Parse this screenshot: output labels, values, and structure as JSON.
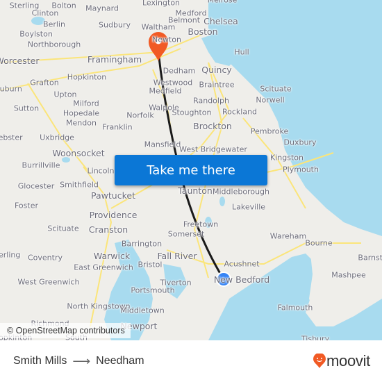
{
  "map": {
    "attribution": "© OpenStreetMap contributors",
    "colors": {
      "land": "#efeeea",
      "water": "#a8dbef",
      "road": "#fbe57a",
      "route_line": "#1a1a1a",
      "destination_pin": "#f15a24",
      "origin_dot": "#3584f5"
    },
    "origin": {
      "label": "Smith Mills",
      "icon": "origin-dot-icon"
    },
    "destination": {
      "label": "Needham",
      "icon": "destination-pin-icon"
    },
    "places": [
      {
        "name": "Sterling",
        "size": "s"
      },
      {
        "name": "Bolton",
        "size": "s"
      },
      {
        "name": "Maynard",
        "size": "s"
      },
      {
        "name": "Lexington",
        "size": "s"
      },
      {
        "name": "Melrose",
        "size": "s"
      },
      {
        "name": "Clinton",
        "size": "s"
      },
      {
        "name": "Medford",
        "size": "s"
      },
      {
        "name": "Berlin",
        "size": "s"
      },
      {
        "name": "Belmont",
        "size": "s"
      },
      {
        "name": "Chelsea",
        "size": "m"
      },
      {
        "name": "Boylston",
        "size": "s"
      },
      {
        "name": "Sudbury",
        "size": "s"
      },
      {
        "name": "Waltham",
        "size": "s"
      },
      {
        "name": "Boston",
        "size": "m"
      },
      {
        "name": "Northborough",
        "size": "s"
      },
      {
        "name": "Newton",
        "size": "s"
      },
      {
        "name": "Hull",
        "size": "s"
      },
      {
        "name": "Worcester",
        "size": "m"
      },
      {
        "name": "Framingham",
        "size": "m"
      },
      {
        "name": "Dedham",
        "size": "s"
      },
      {
        "name": "Quincy",
        "size": "m"
      },
      {
        "name": "Auburn",
        "size": "s"
      },
      {
        "name": "Grafton",
        "size": "s"
      },
      {
        "name": "Hopkinton",
        "size": "s"
      },
      {
        "name": "Westwood",
        "size": "s"
      },
      {
        "name": "Braintree",
        "size": "s"
      },
      {
        "name": "Scituate",
        "size": "s"
      },
      {
        "name": "Upton",
        "size": "s"
      },
      {
        "name": "Medfield",
        "size": "s"
      },
      {
        "name": "Randolph",
        "size": "s"
      },
      {
        "name": "Norwell",
        "size": "s"
      },
      {
        "name": "Sutton",
        "size": "s"
      },
      {
        "name": "Milford",
        "size": "s"
      },
      {
        "name": "Hopedale",
        "size": "s"
      },
      {
        "name": "Walpole",
        "size": "s"
      },
      {
        "name": "Norfolk",
        "size": "s"
      },
      {
        "name": "Stoughton",
        "size": "s"
      },
      {
        "name": "Rockland",
        "size": "s"
      },
      {
        "name": "Mendon",
        "size": "s"
      },
      {
        "name": "Franklin",
        "size": "s"
      },
      {
        "name": "Brockton",
        "size": "m"
      },
      {
        "name": "Pembroke",
        "size": "s"
      },
      {
        "name": "Webster",
        "size": "s"
      },
      {
        "name": "Uxbridge",
        "size": "s"
      },
      {
        "name": "Mansfield",
        "size": "s"
      },
      {
        "name": "West Bridgewater",
        "size": "s"
      },
      {
        "name": "Duxbury",
        "size": "s"
      },
      {
        "name": "Woonsocket",
        "size": "m"
      },
      {
        "name": "Kingston",
        "size": "s"
      },
      {
        "name": "Burrillville",
        "size": "s"
      },
      {
        "name": "Lincoln",
        "size": "s"
      },
      {
        "name": "Plymouth",
        "size": "s"
      },
      {
        "name": "Glocester",
        "size": "s"
      },
      {
        "name": "Smithfield",
        "size": "s"
      },
      {
        "name": "Taunton",
        "size": "m"
      },
      {
        "name": "Middleborough",
        "size": "s"
      },
      {
        "name": "Pawtucket",
        "size": "m"
      },
      {
        "name": "Foster",
        "size": "s"
      },
      {
        "name": "Lakeville",
        "size": "s"
      },
      {
        "name": "Providence",
        "size": "m"
      },
      {
        "name": "Scituate",
        "size": "s"
      },
      {
        "name": "Cranston",
        "size": "m"
      },
      {
        "name": "Freetown",
        "size": "s"
      },
      {
        "name": "Somerset",
        "size": "s"
      },
      {
        "name": "Wareham",
        "size": "s"
      },
      {
        "name": "Barrington",
        "size": "s"
      },
      {
        "name": "Bourne",
        "size": "s"
      },
      {
        "name": "Sterling",
        "size": "s"
      },
      {
        "name": "Coventry",
        "size": "s"
      },
      {
        "name": "Warwick",
        "size": "m"
      },
      {
        "name": "Fall River",
        "size": "m"
      },
      {
        "name": "Acushnet",
        "size": "s"
      },
      {
        "name": "East Greenwich",
        "size": "s"
      },
      {
        "name": "Bristol",
        "size": "s"
      },
      {
        "name": "New Bedford",
        "size": "m"
      },
      {
        "name": "Mashpee",
        "size": "s"
      },
      {
        "name": "West Greenwich",
        "size": "s"
      },
      {
        "name": "Tiverton",
        "size": "s"
      },
      {
        "name": "Portsmouth",
        "size": "s"
      },
      {
        "name": "North Kingstown",
        "size": "s"
      },
      {
        "name": "Middletown",
        "size": "s"
      },
      {
        "name": "Falmouth",
        "size": "s"
      },
      {
        "name": "Richmond",
        "size": "s"
      },
      {
        "name": "Newport",
        "size": "m"
      },
      {
        "name": "Hopkinton",
        "size": "s"
      },
      {
        "name": "South",
        "size": "s"
      },
      {
        "name": "Tisbury",
        "size": "s"
      },
      {
        "name": "Barnstable",
        "size": "s"
      }
    ]
  },
  "cta": {
    "label": "Take me there"
  },
  "footer": {
    "origin": "Smith Mills",
    "arrow": "⟶",
    "destination": "Needham",
    "logo_text": "moovit",
    "logo_color": "#f15a24"
  }
}
